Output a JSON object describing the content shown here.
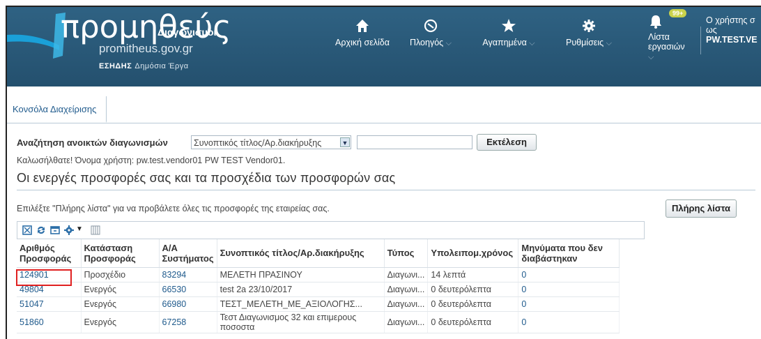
{
  "header": {
    "logo_title": "προμηθεύς",
    "logo_sub": "Διαγωνισμοί",
    "logo_domain": "promitheus.gov.gr",
    "logo_org": "ΕΣΗΔΗΣ",
    "logo_org_sub": "Δημόσια Έργα",
    "nav": [
      {
        "label": "Αρχική σελίδα",
        "icon": "home-icon"
      },
      {
        "label": "Πλοηγός",
        "icon": "compass-icon"
      },
      {
        "label": "Αγαπημένα",
        "icon": "star-icon"
      },
      {
        "label": "Ρυθμίσεις",
        "icon": "gear-icon"
      }
    ],
    "worklist_label_1": "Λίστα",
    "worklist_label_2": "εργασιών",
    "notification_badge": "99+",
    "user_prefix_1": "Ο χρήστης σ",
    "user_prefix_2": "ως",
    "user_name": "PW.TEST.VE",
    "colors": {
      "header_bg": "#2a5a7a",
      "badge": "#c9d24b"
    }
  },
  "tabs": [
    {
      "label": "Κονσόλα Διαχείρισης"
    }
  ],
  "search": {
    "label": "Αναζήτηση ανοικτών διαγωνισμών",
    "selected": "Συνοπτικός τίτλος/Αρ.διακήρυξης",
    "value": "",
    "go_label": "Εκτέλεση"
  },
  "welcome": "Καλωσήλθατε! Όνομα χρήστη: pw.test.vendor01 PW TEST Vendor01.",
  "heading": "Οι ενεργές προσφορές σας και τα προσχέδια των προσφορών σας",
  "hint": "Επιλέξτε \"Πλήρης λίστα\" για να προβάλετε όλες τις προσφορές της εταιρείας σας.",
  "full_list_label": "Πλήρης λίστα",
  "table": {
    "headers": [
      [
        "Αριθμός",
        "Προσφοράς"
      ],
      [
        "Κατάσταση",
        "Προσφοράς"
      ],
      [
        "Α/Α",
        "Συστήματος"
      ],
      [
        "Συνοπτικός τίτλος/Αρ.διακήρυξης"
      ],
      [
        "Τύπος"
      ],
      [
        "Υπολειπομ.χρόνος"
      ],
      [
        "Μηνύματα που δεν",
        "διαβάστηκαν"
      ]
    ],
    "rows": [
      [
        "124901",
        "Προσχέδιο",
        "83294",
        "ΜΕΛΕΤΗ ΠΡΑΣΙΝΟΥ",
        "Διαγωνι...",
        "14 λεπτά",
        "0"
      ],
      [
        "49804",
        "Ενεργός",
        "66530",
        "test 2a 23/10/2017",
        "Διαγωνι...",
        "0 δευτερόλεπτα",
        "0"
      ],
      [
        "51047",
        "Ενεργός",
        "66980",
        "ΤΕΣΤ_ΜΕΛΕΤΗ_ΜΕ_ΑΞΙΟΛΟΓΗΣ...",
        "Διαγωνι...",
        "0 δευτερόλεπτα",
        "0"
      ],
      [
        "51860",
        "Ενεργός",
        "67258",
        "Τεστ Διαγωνισμος 32 και επιμερους ποσοστα",
        "Διαγωνι...",
        "0 δευτερόλεπτα",
        "0"
      ]
    ]
  }
}
